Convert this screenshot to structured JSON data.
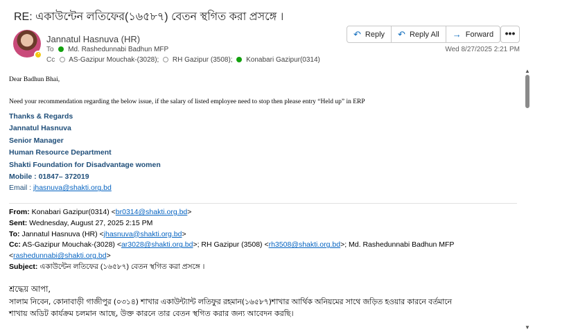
{
  "subject": "RE: একাউন্টেন লতিফের(১৬৫৮৭) বেতন স্থগিত করা প্রসঙ্গে ।",
  "sender": {
    "name": "Jannatul Hasnuva (HR)"
  },
  "to": {
    "label": "To",
    "name": "Md. Rashedunnabi Badhun MFP"
  },
  "cc": {
    "label": "Cc",
    "recipients": [
      "AS-Gazipur Mouchak-(3028);",
      "RH Gazipur (3508);",
      "Konabari Gazipur(0314)"
    ]
  },
  "actions": {
    "reply": "Reply",
    "reply_all": "Reply All",
    "forward": "Forward",
    "more": "•••"
  },
  "date": "Wed 8/27/2025 2:21 PM",
  "body": {
    "greeting": "Dear Badhun Bhai,",
    "message": "Need your recommendation regarding the below issue, if the salary of listed employee need to stop then please entry “Held up” in ERP",
    "signature": [
      "Thanks & Regards",
      "Jannatul Hasnuva",
      "Senior Manager",
      "Human Resource Department",
      "Shakti Foundation for Disadvantage women",
      "Mobile : 01847– 372019"
    ],
    "email_label": "Email  :",
    "email": "jhasnuva@shakti.org.bd"
  },
  "forwarded": {
    "from_label": "From:",
    "from_name": "Konabari Gazipur(0314) <",
    "from_email": "br0314@shakti.org.bd",
    "from_end": ">",
    "sent_label": "Sent:",
    "sent": "Wednesday, August 27, 2025 2:15 PM",
    "to_label": "To:",
    "to_name": "Jannatul Hasnuva (HR) <",
    "to_email": "jhasnuva@shakti.org.bd",
    "to_end": ">",
    "cc_label": "Cc:",
    "cc_1": "AS-Gazipur Mouchak-(3028) <",
    "cc_1_email": "ar3028@shakti.org.bd",
    "cc_2": ">; RH Gazipur (3508) <",
    "cc_2_email": "rh3508@shakti.org.bd",
    "cc_3": ">; Md. Rashedunnabi Badhun MFP",
    "cc_4": "<",
    "cc_3_email": "rashedunnabi@shakti.org.bd",
    "cc_end": ">",
    "subject_label": "Subject:",
    "subject": "একাউন্টেন লতিফের (১৬৫৮৭) বেতন স্থগিত করা প্রসঙ্গে ।",
    "bangla_greeting": "শ্রদ্ধেয় আপা,",
    "bangla_line1": "সালাম নিবেন, কোনাবাড়ী গাজীপুর (০৩১৪) শাখার একাউন্ট্যান্ট লতিফুর রহমান(১৬৫৮৭)শাখার আর্থিক অনিয়মের সাথে জড়িত হওয়ার কারনে বর্তমানে",
    "bangla_line2": "শাখায় অডিট কার্যক্রম চলমান আছে, উক্ত কারনে তার বেতন স্থগিত করার জন্য আবেদন করছি।"
  }
}
